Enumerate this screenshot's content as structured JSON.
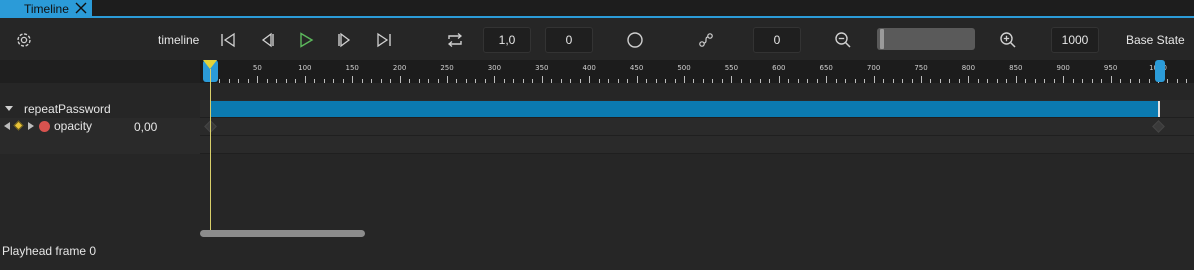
{
  "tab": {
    "title": "Timeline"
  },
  "toolbar": {
    "timeline_label": "timeline",
    "playback_speed": "1,0",
    "start_frame": "0",
    "keyframe_value": "0",
    "end_frame": "1000",
    "state_label": "Base State"
  },
  "ruler": {
    "labels": [
      "50",
      "100",
      "150",
      "200",
      "250",
      "300",
      "350",
      "400",
      "450",
      "500",
      "550",
      "600",
      "650",
      "700",
      "750",
      "800",
      "850",
      "900",
      "950",
      "1000"
    ]
  },
  "tracks": {
    "section": {
      "label": "repeatPassword"
    },
    "property": {
      "label": "opacity",
      "value": "0,00"
    }
  },
  "status": {
    "text": "Playhead frame 0"
  },
  "colors": {
    "accent": "#2b9bd8",
    "section_bar": "#0b7ab0",
    "playhead": "#e3d33a",
    "record": "#d9534f"
  }
}
